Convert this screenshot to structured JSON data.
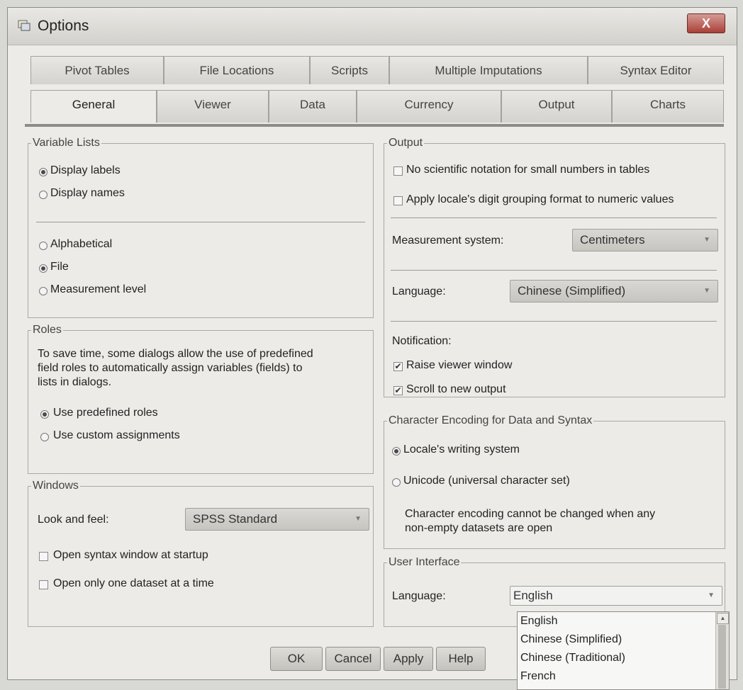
{
  "window": {
    "title": "Options",
    "close_label": "X"
  },
  "tabs_row1": [
    "Pivot Tables",
    "File Locations",
    "Scripts",
    "Multiple Imputations",
    "Syntax Editor"
  ],
  "tabs_row2": [
    "General",
    "Viewer",
    "Data",
    "Currency",
    "Output",
    "Charts"
  ],
  "variable_lists": {
    "legend": "Variable Lists",
    "display_labels": "Display labels",
    "display_names": "Display names",
    "alphabetical": "Alphabetical",
    "file": "File",
    "measurement_level": "Measurement level"
  },
  "roles": {
    "legend": "Roles",
    "desc_line1": "To save time, some dialogs allow the use of predefined",
    "desc_line2": "field roles to automatically assign variables (fields) to",
    "desc_line3": "lists in dialogs.",
    "use_predefined": "Use predefined roles",
    "use_custom": "Use custom assignments"
  },
  "windows": {
    "legend": "Windows",
    "look_and_feel_label": "Look and feel:",
    "look_and_feel_value": "SPSS Standard",
    "open_syntax": "Open syntax window at startup",
    "open_one_dataset": "Open only one dataset at a time"
  },
  "output": {
    "legend": "Output",
    "no_scientific": "No scientific notation for small numbers in tables",
    "apply_locale": "Apply locale's digit  grouping format to numeric values",
    "measurement_label": "Measurement system:",
    "measurement_value": "Centimeters",
    "language_label": "Language:",
    "language_value": "Chinese (Simplified)",
    "notification_label": "Notification:",
    "raise_viewer": "Raise viewer window",
    "scroll_output": "Scroll to new output"
  },
  "encoding": {
    "legend": "Character Encoding for Data and Syntax",
    "locale_writing": "Locale's writing system",
    "unicode": "Unicode (universal character set)",
    "note_line1": "Character encoding cannot be changed when any",
    "note_line2": "non-empty datasets are open"
  },
  "ui": {
    "legend": "User Interface",
    "language_label": "Language:",
    "language_value": "English",
    "options": [
      "English",
      "Chinese (Simplified)",
      "Chinese (Traditional)",
      "French"
    ]
  },
  "buttons": {
    "ok": "OK",
    "cancel": "Cancel",
    "apply": "Apply",
    "help": "Help"
  }
}
